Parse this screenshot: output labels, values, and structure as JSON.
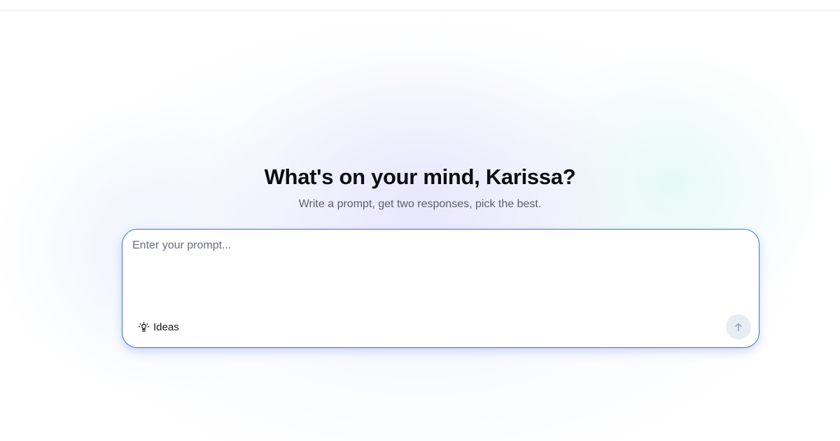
{
  "header": {
    "greeting": "What's on your mind, Karissa?",
    "subtitle": "Write a prompt, get two responses, pick the best."
  },
  "prompt": {
    "placeholder": "Enter your prompt...",
    "value": "",
    "ideas_label": "Ideas",
    "ideas_icon": "lightbulb-icon",
    "send_icon": "arrow-up-icon"
  },
  "colors": {
    "accent_border": "#4a74d9",
    "send_button_bg": "#e6edf4",
    "send_arrow": "#8a97a8"
  }
}
